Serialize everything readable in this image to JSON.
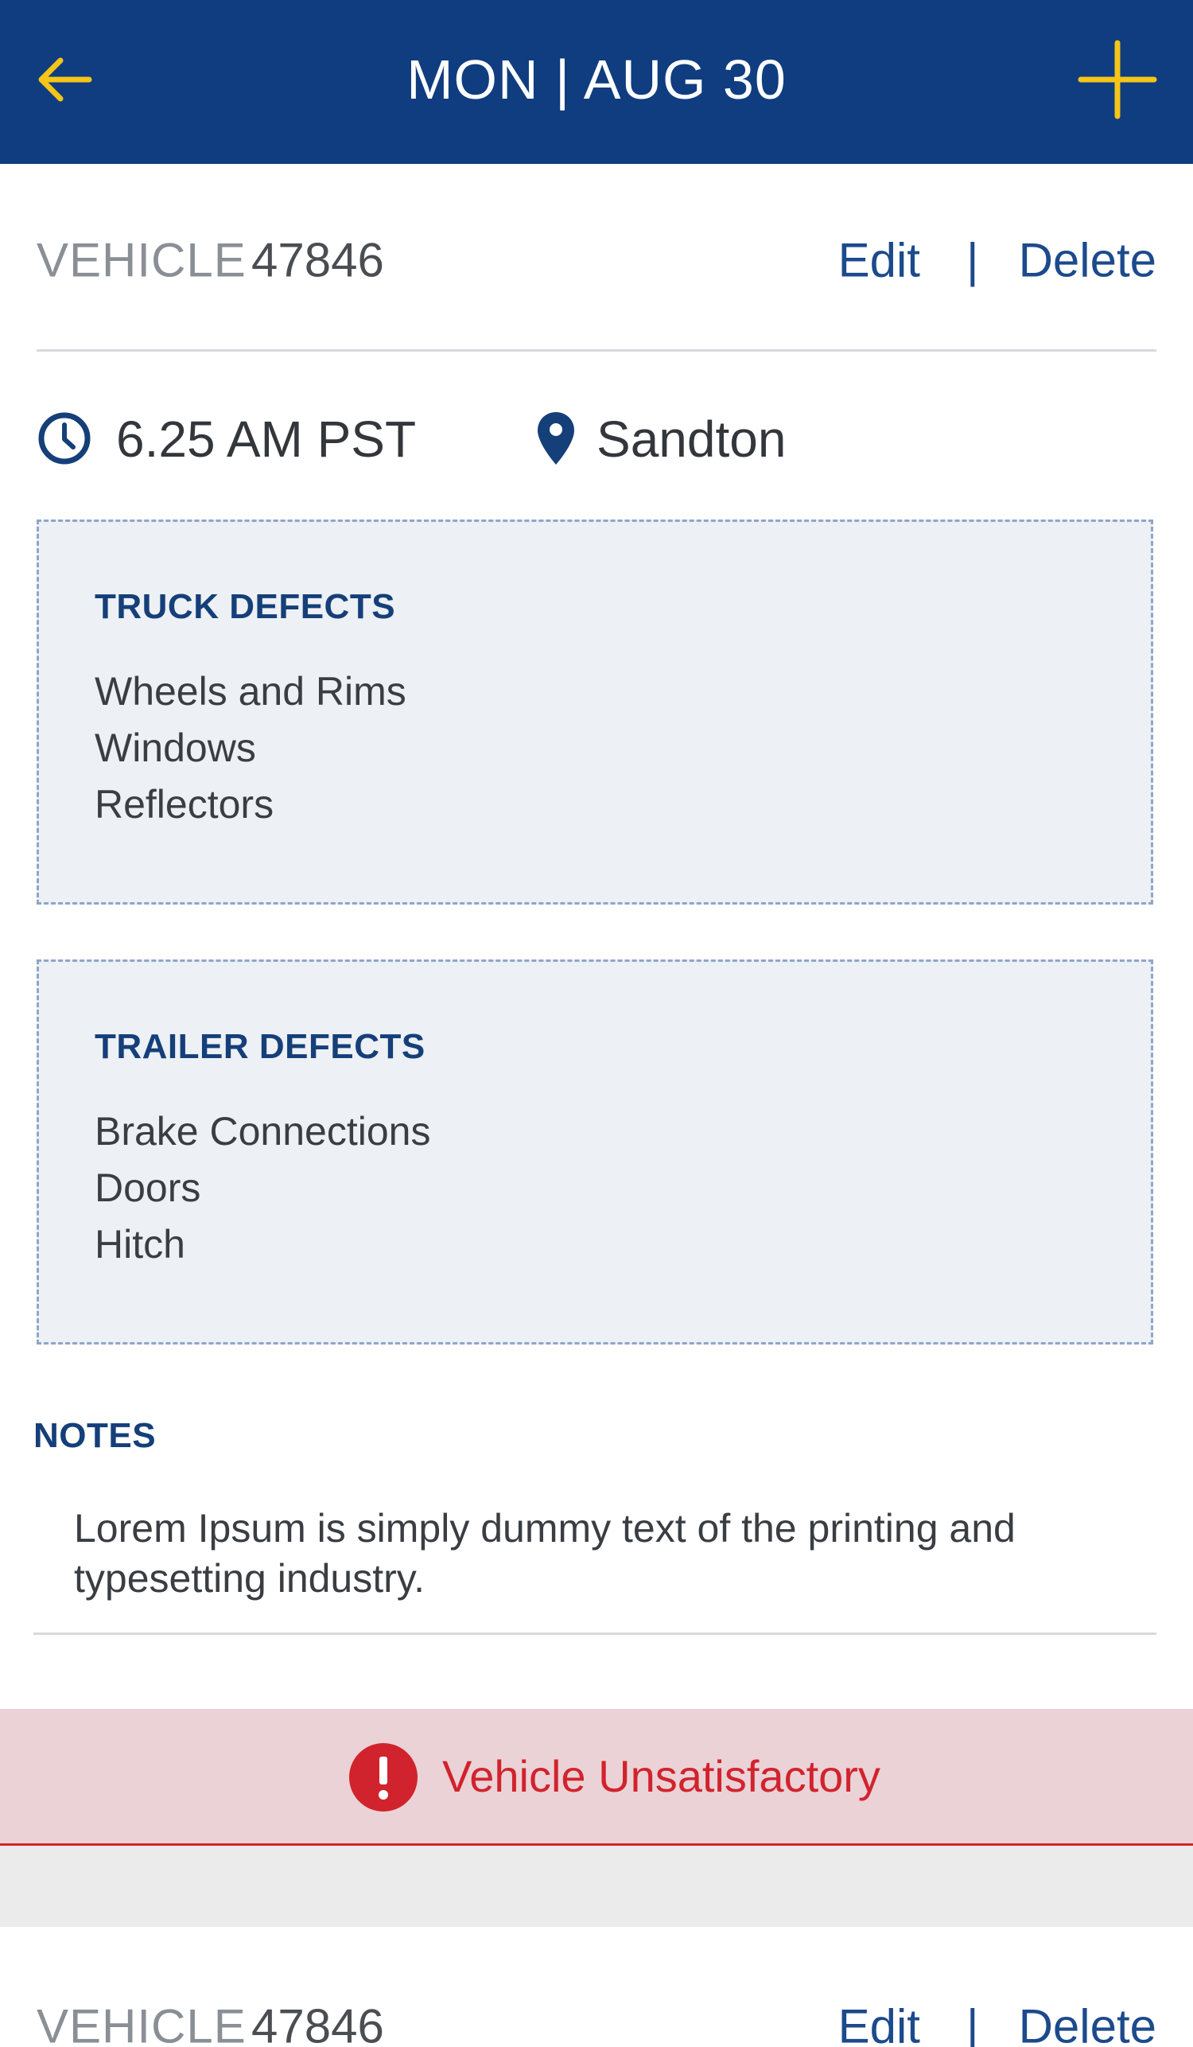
{
  "header": {
    "title": "MON | AUG 30",
    "back_icon": "arrow-left-icon",
    "add_icon": "plus-icon",
    "bg_color": "#0f3d7f",
    "accent_color": "#f5c518"
  },
  "vehicle": {
    "label": "VEHICLE",
    "number": "47846",
    "edit_label": "Edit",
    "separator": "|",
    "delete_label": "Delete"
  },
  "meta": {
    "time": "6.25 AM PST",
    "location": "Sandton",
    "time_icon": "clock-icon",
    "location_icon": "map-pin-icon"
  },
  "truck_defects": {
    "heading": "TRUCK DEFECTS",
    "items": [
      "Wheels and Rims",
      "Windows",
      "Reflectors"
    ]
  },
  "trailer_defects": {
    "heading": "TRAILER DEFECTS",
    "items": [
      "Brake Connections",
      "Doors",
      "Hitch"
    ]
  },
  "notes": {
    "heading": "NOTES",
    "text": "Lorem Ipsum is simply dummy text of the printing and typesetting industry."
  },
  "status": {
    "text": "Vehicle Unsatisfactory",
    "icon": "alert-circle-icon",
    "color": "#d1232d"
  },
  "next_vehicle": {
    "label": "VEHICLE",
    "number": "47846",
    "edit_label": "Edit",
    "separator": "|",
    "delete_label": "Delete"
  }
}
